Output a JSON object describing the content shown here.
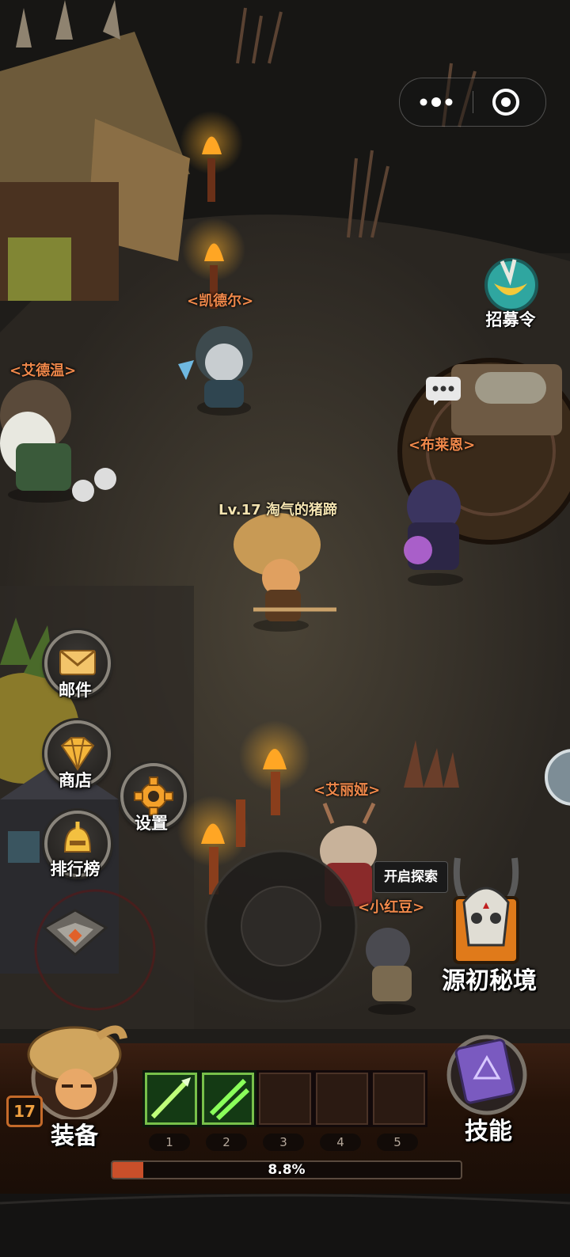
{
  "top_capsule": {
    "more_icon": "more-dots-icon",
    "close_icon": "target-circle-icon"
  },
  "npcs": [
    {
      "name": "<凯德尔>"
    },
    {
      "name": "<艾德温>"
    },
    {
      "name": "<布莱恩>"
    },
    {
      "name": "<艾丽娅>"
    },
    {
      "name": "<小红豆>"
    }
  ],
  "player": {
    "name": "Lv.17 淘气的猪蹄",
    "level": 17
  },
  "recruit": {
    "label": "招募令",
    "icon": "recruit-scroll-icon"
  },
  "left_menu": {
    "mail": {
      "label": "邮件",
      "icon": "envelope-icon"
    },
    "shop": {
      "label": "商店",
      "icon": "diamond-icon"
    },
    "settings": {
      "label": "设置",
      "icon": "gear-icon"
    },
    "ranking": {
      "label": "排行榜",
      "icon": "helmet-icon"
    },
    "collapse_icon": "chevron-down-icon"
  },
  "explore_tooltip": "开启探索",
  "dungeon": {
    "label": "源初秘境",
    "icon": "horned-skull-icon"
  },
  "equipment": {
    "label": "装备",
    "level_badge": "17"
  },
  "skills": {
    "label": "技能",
    "icon": "spellbook-icon"
  },
  "skill_slots": [
    {
      "number": "1",
      "filled": true
    },
    {
      "number": "2",
      "filled": true
    },
    {
      "number": "3",
      "filled": false
    },
    {
      "number": "4",
      "filled": false
    },
    {
      "number": "5",
      "filled": false
    }
  ],
  "xp": {
    "percent_label": "8.8%",
    "fraction": 0.088
  },
  "colors": {
    "npc_name": "#f0884a",
    "xp_fill": "#c94f2a",
    "ground": "#3a352d"
  }
}
